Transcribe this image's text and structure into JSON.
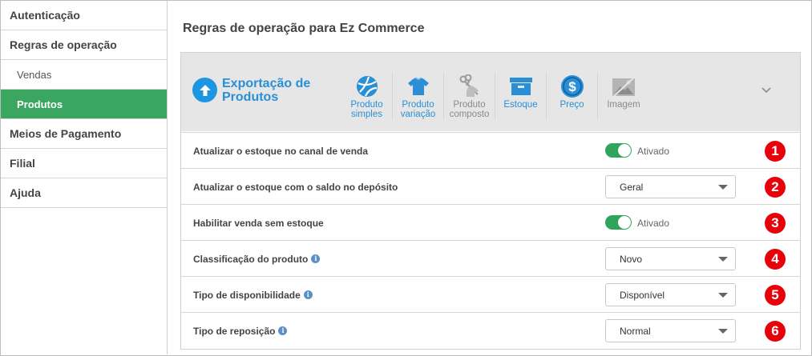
{
  "sidebar": {
    "items": [
      {
        "label": "Autenticação"
      },
      {
        "label": "Regras de operação"
      },
      {
        "label": "Vendas"
      },
      {
        "label": "Produtos"
      },
      {
        "label": "Meios de Pagamento"
      },
      {
        "label": "Filial"
      },
      {
        "label": "Ajuda"
      }
    ]
  },
  "page": {
    "title": "Regras de operação para Ez Commerce"
  },
  "header": {
    "export_title": "Exportação de Produtos",
    "types": [
      {
        "label_line1": "Produto",
        "label_line2": "simples",
        "icon": "ball-icon",
        "color": "#2a8fd6"
      },
      {
        "label_line1": "Produto",
        "label_line2": "variação",
        "icon": "tshirt-icon",
        "color": "#2a8fd6"
      },
      {
        "label_line1": "Produto",
        "label_line2": "composto",
        "icon": "scissors-shirt-icon",
        "color": "#8a8a8a"
      },
      {
        "label_line1": "Estoque",
        "label_line2": "",
        "icon": "box-icon",
        "color": "#2a8fd6"
      },
      {
        "label_line1": "Preço",
        "label_line2": "",
        "icon": "dollar-icon",
        "color": "#2a8fd6"
      },
      {
        "label_line1": "Imagem",
        "label_line2": "",
        "icon": "image-icon",
        "color": "#8a8a8a"
      }
    ]
  },
  "rows": [
    {
      "label": "Atualizar o estoque no canal de venda",
      "control": "toggle",
      "value": "Ativado",
      "badge": "1"
    },
    {
      "label": "Atualizar o estoque com o saldo no depósito",
      "control": "select",
      "value": "Geral",
      "badge": "2"
    },
    {
      "label": "Habilitar venda sem estoque",
      "control": "toggle",
      "value": "Ativado",
      "badge": "3"
    },
    {
      "label": "Classificação do produto",
      "control": "select",
      "value": "Novo",
      "badge": "4"
    },
    {
      "label": "Tipo de disponibilidade",
      "control": "select",
      "value": "Disponível",
      "badge": "5"
    },
    {
      "label": "Tipo de reposição",
      "control": "select",
      "value": "Normal",
      "badge": "6"
    }
  ],
  "colors": {
    "accent_green": "#3aa660",
    "accent_blue": "#2a8fd6",
    "badge_red": "#e8000b"
  }
}
